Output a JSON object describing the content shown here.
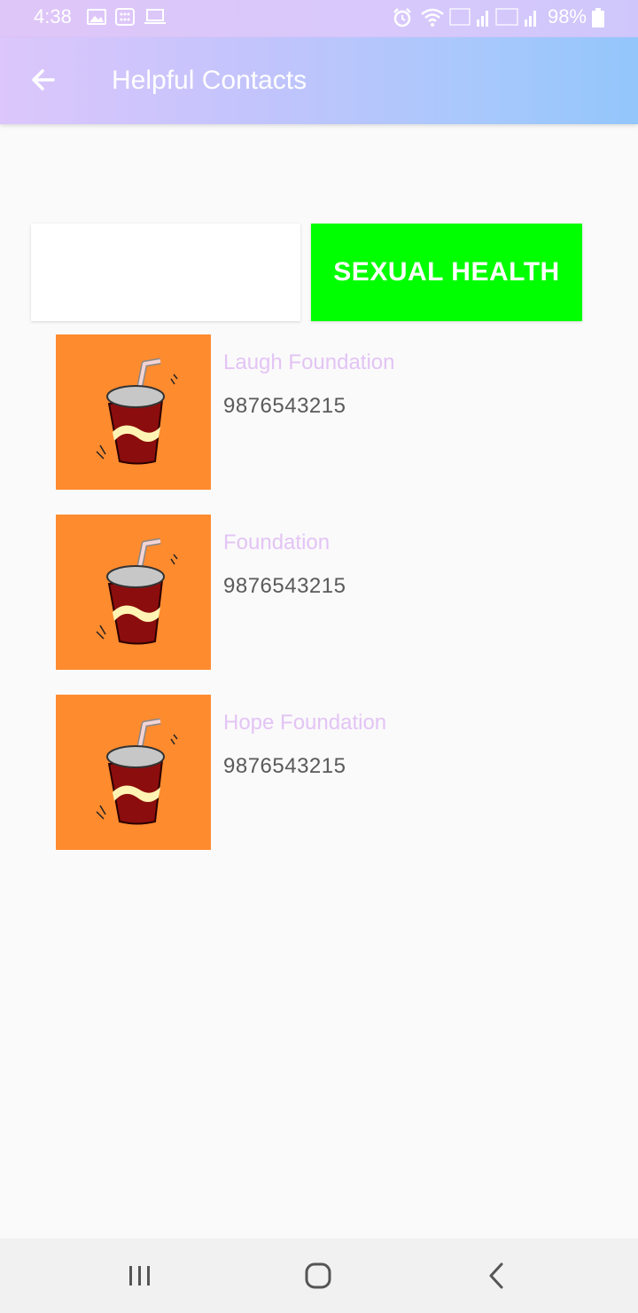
{
  "status_bar": {
    "time": "4:38",
    "battery": "98%"
  },
  "app_bar": {
    "title": "Helpful Contacts"
  },
  "categories": {
    "active_label": "SEXUAL HEALTH",
    "active_color": "#00ff00"
  },
  "contacts": [
    {
      "name": "Laugh Foundation",
      "phone": "9876543215"
    },
    {
      "name": "Foundation",
      "phone": "9876543215"
    },
    {
      "name": "Hope Foundation",
      "phone": "9876543215"
    }
  ],
  "colors": {
    "thumb_background": "#ff8b2f",
    "contact_name": "#e3c4f5",
    "contact_phone": "#5a5a5a"
  },
  "icons": {
    "thumbnail": "soda-cup-icon"
  }
}
